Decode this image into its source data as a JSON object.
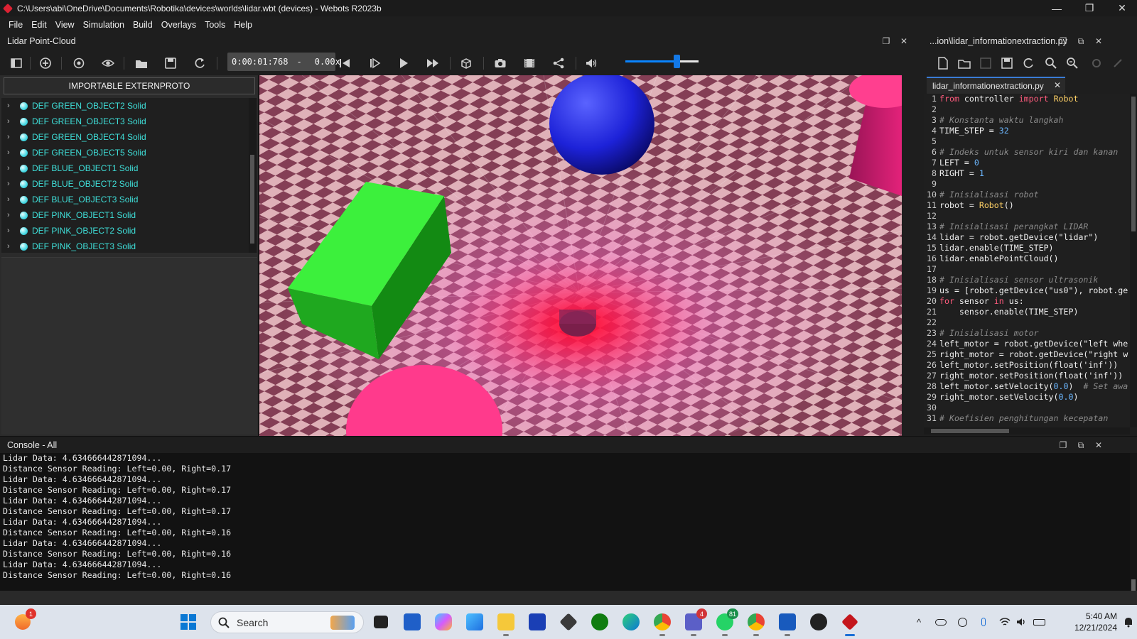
{
  "window": {
    "title": "C:\\Users\\abi\\OneDrive\\Documents\\Robotika\\devices\\worlds\\lidar.wbt (devices) - Webots R2023b",
    "minimize": "—",
    "maximize": "❐",
    "close": "✕"
  },
  "menu": [
    "File",
    "Edit",
    "View",
    "Simulation",
    "Build",
    "Overlays",
    "Tools",
    "Help"
  ],
  "scene_dock": {
    "title": "Lidar Point-Cloud",
    "float_icon": "❐",
    "close_icon": "✕"
  },
  "toolbar": {
    "time": "0:00:01:768",
    "time_sep": "-",
    "speed": "0.00x",
    "volume_level": 0.7
  },
  "scene_tree": {
    "externproto_button": "IMPORTABLE EXTERNPROTO",
    "chevron": "›",
    "items": [
      "DEF GREEN_OBJECT2 Solid",
      "DEF GREEN_OBJECT3 Solid",
      "DEF GREEN_OBJECT4 Solid",
      "DEF GREEN_OBJECT5 Solid",
      "DEF BLUE_OBJECT1 Solid",
      "DEF BLUE_OBJECT2 Solid",
      "DEF BLUE_OBJECT3 Solid",
      "DEF PINK_OBJECT1 Solid",
      "DEF PINK_OBJECT2 Solid",
      "DEF PINK_OBJECT3 Solid"
    ]
  },
  "editor_dock": {
    "title": "...ion\\lidar_informationextraction.py",
    "tab": "lidar_informationextraction.py",
    "tab_close": "✕",
    "float_icon": "❐",
    "restore_icon": "⧉",
    "close_icon": "✕"
  },
  "code": [
    {
      "n": "1",
      "t": "from controller import Robot"
    },
    {
      "n": "2",
      "t": ""
    },
    {
      "n": "3",
      "t": "# Konstanta waktu langkah"
    },
    {
      "n": "4",
      "t": "TIME_STEP = 32"
    },
    {
      "n": "5",
      "t": ""
    },
    {
      "n": "6",
      "t": "# Indeks untuk sensor kiri dan kanan"
    },
    {
      "n": "7",
      "t": "LEFT = 0"
    },
    {
      "n": "8",
      "t": "RIGHT = 1"
    },
    {
      "n": "9",
      "t": ""
    },
    {
      "n": "10",
      "t": "# Inisialisasi robot"
    },
    {
      "n": "11",
      "t": "robot = Robot()"
    },
    {
      "n": "12",
      "t": ""
    },
    {
      "n": "13",
      "t": "# Inisialisasi perangkat LIDAR"
    },
    {
      "n": "14",
      "t": "lidar = robot.getDevice(\"lidar\")"
    },
    {
      "n": "15",
      "t": "lidar.enable(TIME_STEP)"
    },
    {
      "n": "16",
      "t": "lidar.enablePointCloud()"
    },
    {
      "n": "17",
      "t": ""
    },
    {
      "n": "18",
      "t": "# Inisialisasi sensor ultrasonik"
    },
    {
      "n": "19",
      "t": "us = [robot.getDevice(\"us0\"), robot.ge"
    },
    {
      "n": "20",
      "t": "for sensor in us:"
    },
    {
      "n": "21",
      "t": "    sensor.enable(TIME_STEP)"
    },
    {
      "n": "22",
      "t": ""
    },
    {
      "n": "23",
      "t": "# Inisialisasi motor"
    },
    {
      "n": "24",
      "t": "left_motor = robot.getDevice(\"left whe"
    },
    {
      "n": "25",
      "t": "right_motor = robot.getDevice(\"right w"
    },
    {
      "n": "26",
      "t": "left_motor.setPosition(float('inf'))"
    },
    {
      "n": "27",
      "t": "right_motor.setPosition(float('inf'))"
    },
    {
      "n": "28",
      "t": "left_motor.setVelocity(0.0)  # Set awa"
    },
    {
      "n": "29",
      "t": "right_motor.setVelocity(0.0)"
    },
    {
      "n": "30",
      "t": ""
    },
    {
      "n": "31",
      "t": "# Koefisien penghitungan kecepatan"
    }
  ],
  "console": {
    "title": "Console - All",
    "lines": [
      "Lidar Data: 4.634666442871094...",
      "Distance Sensor Reading: Left=0.00, Right=0.17",
      "Lidar Data: 4.634666442871094...",
      "Distance Sensor Reading: Left=0.00, Right=0.17",
      "Lidar Data: 4.634666442871094...",
      "Distance Sensor Reading: Left=0.00, Right=0.17",
      "Lidar Data: 4.634666442871094...",
      "Distance Sensor Reading: Left=0.00, Right=0.16",
      "Lidar Data: 4.634666442871094...",
      "Distance Sensor Reading: Left=0.00, Right=0.16",
      "Lidar Data: 4.634666442871094...",
      "Distance Sensor Reading: Left=0.00, Right=0.16"
    ]
  },
  "taskbar": {
    "search_label": "Search",
    "weather_badge": "1",
    "teams_badge": "4",
    "whatsapp_badge": "81",
    "time": "5:40 AM",
    "date": "12/21/2024",
    "tray_chevron": "^"
  },
  "colors": {
    "accent": "#0a84ff",
    "tree_text": "#3fe0da",
    "keyword": "#ff5b7d",
    "class": "#ffd166",
    "comment": "#8a8a8a",
    "number": "#6cb7ff"
  }
}
